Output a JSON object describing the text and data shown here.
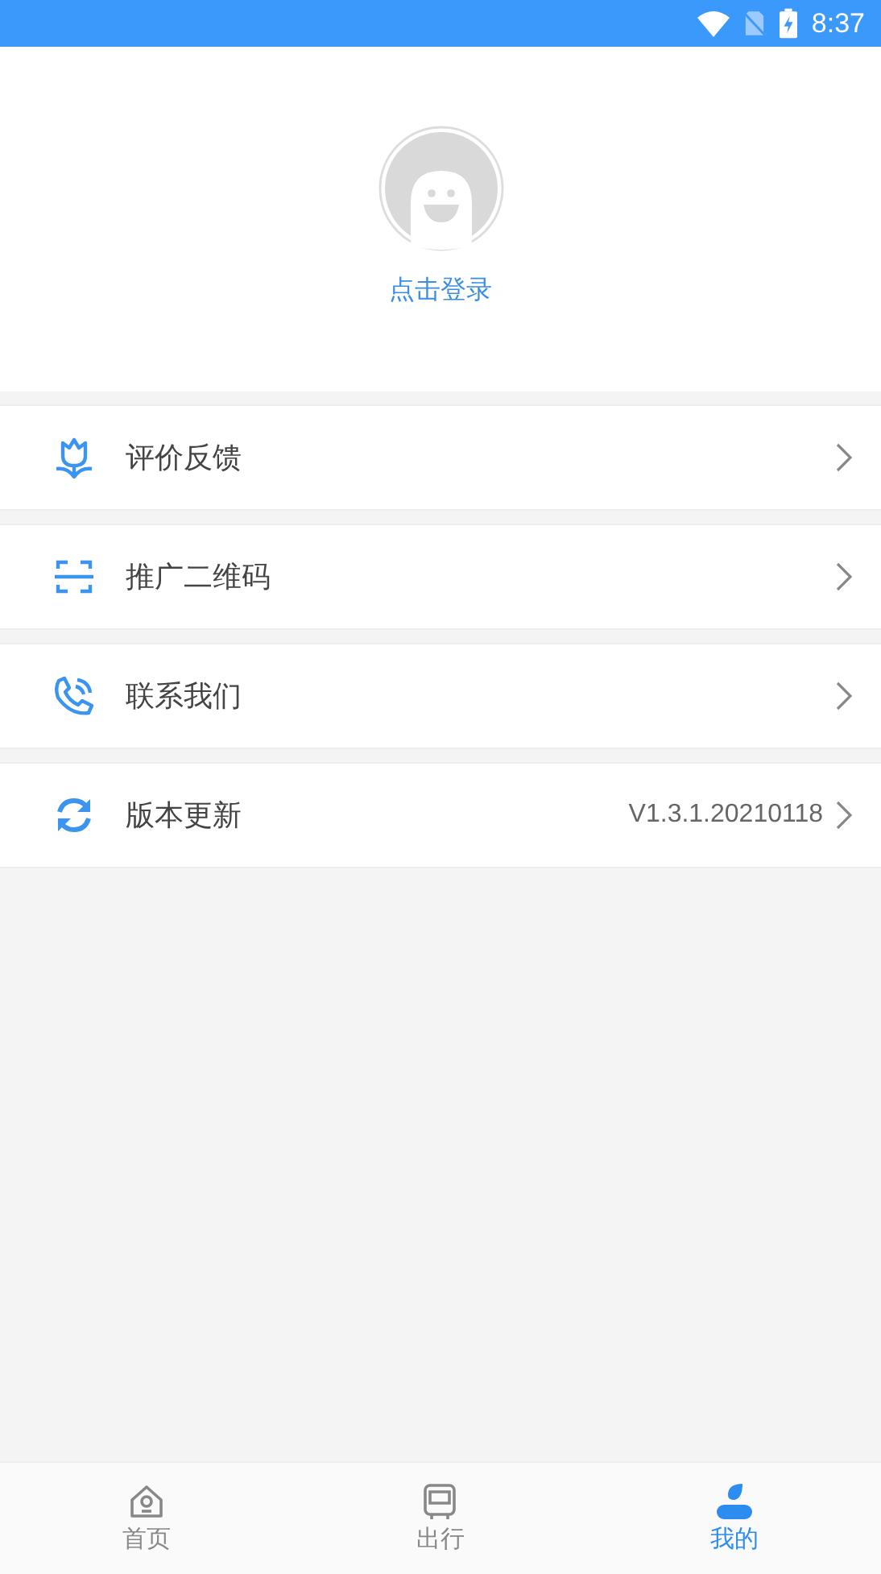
{
  "status_bar": {
    "time": "8:37"
  },
  "profile": {
    "login_label": "点击登录"
  },
  "menu": [
    {
      "label": "评价反馈"
    },
    {
      "label": "推广二维码"
    },
    {
      "label": "联系我们"
    },
    {
      "label": "版本更新",
      "value": "V1.3.1.20210118"
    }
  ],
  "tabs": [
    {
      "label": "首页",
      "selected": false
    },
    {
      "label": "出行",
      "selected": false
    },
    {
      "label": "我的",
      "selected": true
    }
  ]
}
